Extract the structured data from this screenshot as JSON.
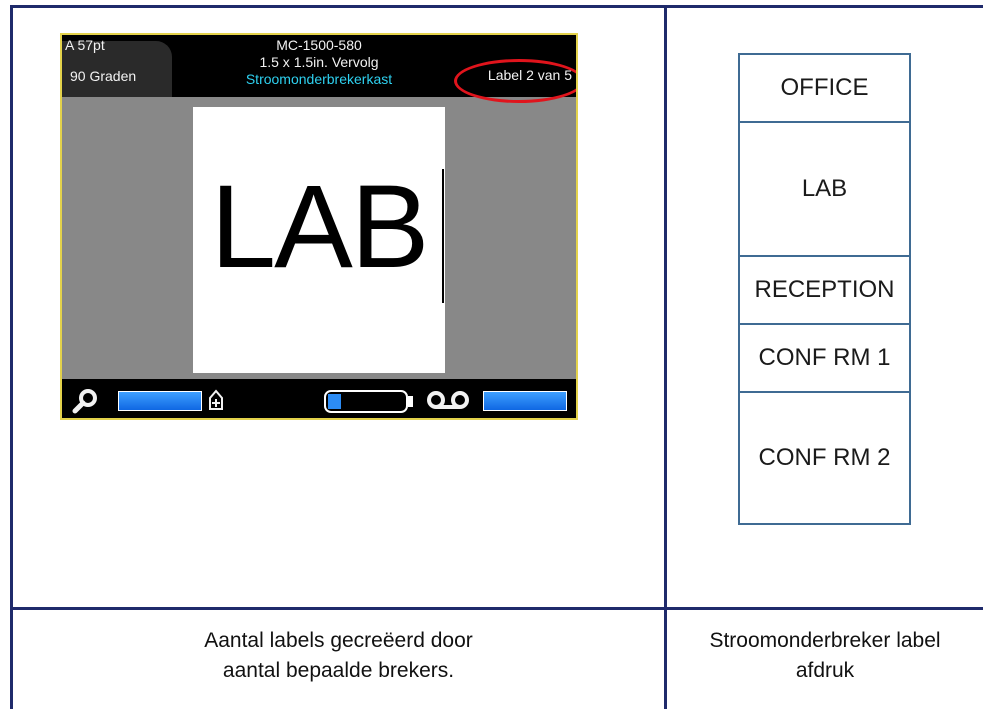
{
  "device": {
    "font_size": "A 57pt",
    "rotation": "90 Graden",
    "part_number": "MC-1500-580",
    "label_size": "1.5 x 1.5in. Vervolg",
    "application": "Stroomonderbrekerkast",
    "label_count": "Label 2 van 5",
    "label_text": "LAB",
    "icons": [
      "zoom-icon",
      "print-quality-icon",
      "battery-icon",
      "tape-icon"
    ],
    "battery_level": 0.17,
    "accent_color": "#2ed1f0",
    "highlight_color": "#e0141c"
  },
  "labels": [
    "OFFICE",
    "LAB",
    "RECEPTION",
    "CONF RM 1",
    "CONF RM 2"
  ],
  "captions": {
    "left_line1": "Aantal labels gecreëerd door",
    "left_line2": "aantal bepaalde brekers.",
    "right_line1": "Stroomonderbreker label",
    "right_line2": "afdruk"
  }
}
